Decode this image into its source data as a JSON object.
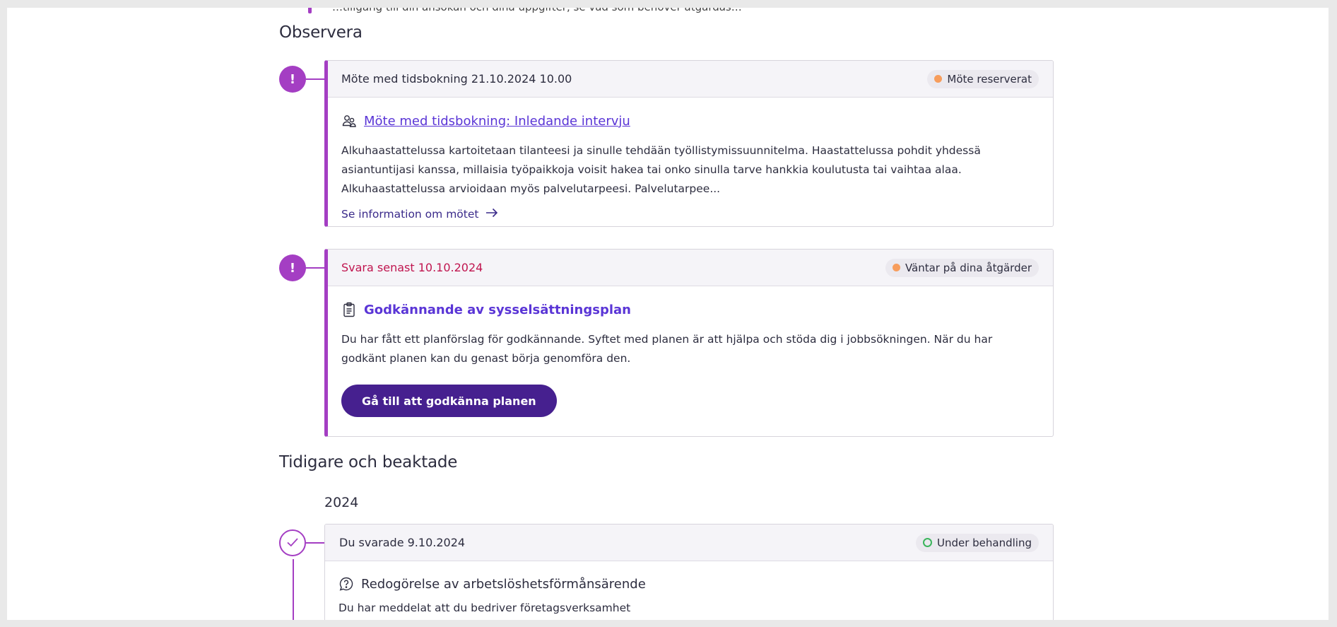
{
  "top_strip": {
    "text": "…tillgång till din ansökan och dina uppgifter, se vad som behöver åtgärdas…"
  },
  "observe_section": {
    "title": "Observera"
  },
  "meeting_card": {
    "header_text": "Möte med tidsbokning 21.10.2024 10.00",
    "status": "Möte reserverat",
    "title": "Möte med tidsbokning: Inledande intervju",
    "description": "Alkuhaastattelussa kartoitetaan tilanteesi ja sinulle tehdään työllistymissuunnitelma. Haastattelussa pohdit yhdessä asiantuntijasi kanssa, millaisia työpaikkoja voisit hakea tai onko sinulla tarve hankkia koulutusta tai vaihtaa alaa. Alkuhaastattelussa arvioidaan myös palvelutarpeesi. Palvelutarpee...",
    "link_text": "Se information om mötet"
  },
  "plan_card": {
    "header_text": "Svara senast 10.10.2024",
    "status": "Väntar på dina åtgärder",
    "title": "Godkännande av sysselsättningsplan",
    "description": "Du har fått ett planförslag för godkännande. Syftet med planen är att hjälpa och stöda dig i jobbsökningen. När du har godkänt planen kan du genast börja genomföra den.",
    "button_label": "Gå till att godkänna planen"
  },
  "previous_section": {
    "title": "Tidigare och beaktade",
    "year": "2024"
  },
  "answered_card": {
    "header_text": "Du svarade 9.10.2024",
    "status": "Under behandling",
    "title": "Redogörelse av arbetslöshetsförmånsärende",
    "description": "Du har meddelat att du bedriver företagsverksamhet"
  },
  "markers": {
    "alert_symbol": "!"
  },
  "colors": {
    "accent": "#a43ec3",
    "primary_button": "#46208f",
    "link": "#5a35d6",
    "urgent_text": "#c0154f",
    "status_orange": "#f79d5c",
    "status_green": "#3bb55c"
  },
  "icons": {
    "meeting": "people-meeting-icon",
    "plan": "clipboard-icon",
    "question": "question-bubble-icon",
    "arrow": "arrow-right-icon",
    "check": "check-icon"
  }
}
